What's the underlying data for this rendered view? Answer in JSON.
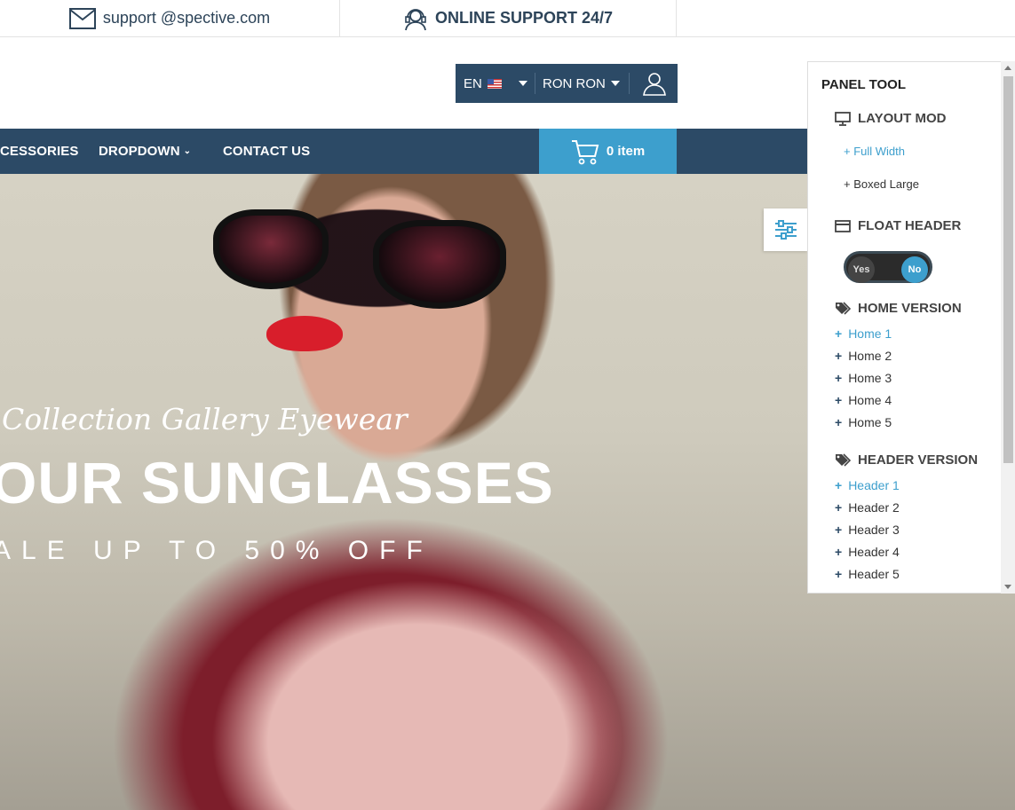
{
  "topbar": {
    "email": "support @spective.com",
    "support": "ONLINE SUPPORT 24/7"
  },
  "account": {
    "language": "EN",
    "user": "RON RON"
  },
  "nav": {
    "items": [
      "CESSORIES",
      "DROPDOWN",
      "CONTACT US"
    ]
  },
  "cart": {
    "label": "0 item"
  },
  "hero": {
    "subtitle": "Collection Gallery Eyewear",
    "title": "OUR SUNGLASSES",
    "sale": "ALE UP TO 50% OFF"
  },
  "panel": {
    "title": "PANEL TOOL",
    "layout": {
      "heading": "LAYOUT MOD",
      "options": [
        "+ Full Width",
        "+ Boxed Large"
      ]
    },
    "float_header": {
      "heading": "FLOAT HEADER",
      "yes": "Yes",
      "no": "No",
      "selected": "No"
    },
    "home_version": {
      "heading": "HOME VERSION",
      "items": [
        "Home 1",
        "Home 2",
        "Home 3",
        "Home 4",
        "Home 5"
      ]
    },
    "header_version": {
      "heading": "HEADER VERSION",
      "items": [
        "Header 1",
        "Header 2",
        "Header 3",
        "Header 4",
        "Header 5"
      ]
    }
  },
  "colors": {
    "navy": "#2c4a66",
    "accent": "#3d9fcd"
  }
}
